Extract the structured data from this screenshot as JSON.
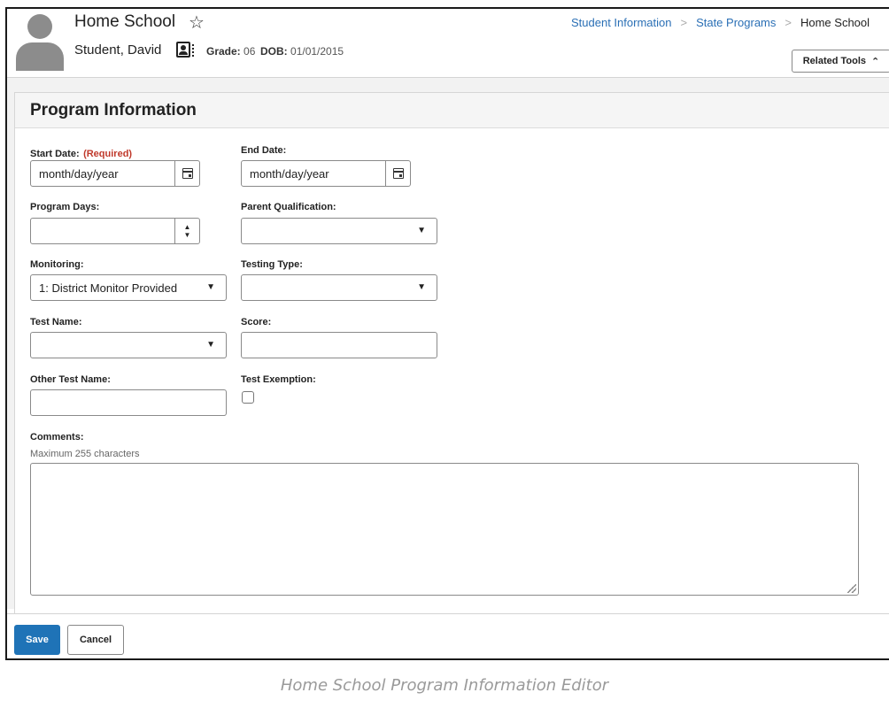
{
  "header": {
    "title": "Home School",
    "student_name": "Student, David",
    "grade_label": "Grade:",
    "grade_value": "06",
    "dob_label": "DOB:",
    "dob_value": "01/01/2015",
    "related_tools_label": "Related Tools",
    "breadcrumb": [
      "Student Information",
      "State Programs",
      "Home School"
    ]
  },
  "panel": {
    "title": "Program Information"
  },
  "form": {
    "start_date": {
      "label": "Start Date:",
      "required": "(Required)",
      "placeholder": "month/day/year"
    },
    "end_date": {
      "label": "End Date:",
      "placeholder": "month/day/year"
    },
    "program_days": {
      "label": "Program Days:",
      "value": ""
    },
    "parent_qualification": {
      "label": "Parent Qualification:",
      "value": ""
    },
    "monitoring": {
      "label": "Monitoring:",
      "value": "1: District Monitor Provided"
    },
    "testing_type": {
      "label": "Testing Type:",
      "value": ""
    },
    "test_name": {
      "label": "Test Name:",
      "value": ""
    },
    "score": {
      "label": "Score:",
      "value": ""
    },
    "other_test_name": {
      "label": "Other Test Name:",
      "value": ""
    },
    "test_exemption": {
      "label": "Test Exemption:",
      "checked": false
    },
    "comments": {
      "label": "Comments:",
      "hint": "Maximum 255 characters",
      "value": ""
    }
  },
  "footer": {
    "save_label": "Save",
    "cancel_label": "Cancel"
  },
  "caption": "Home School Program Information Editor",
  "colors": {
    "accent": "#1f73b7",
    "link": "#2a6fb5",
    "required": "#c0392b"
  },
  "icons": [
    "star-icon",
    "contact-card-icon",
    "chevron-up-icon",
    "calendar-icon",
    "caret-down-icon",
    "spinner-icon"
  ]
}
